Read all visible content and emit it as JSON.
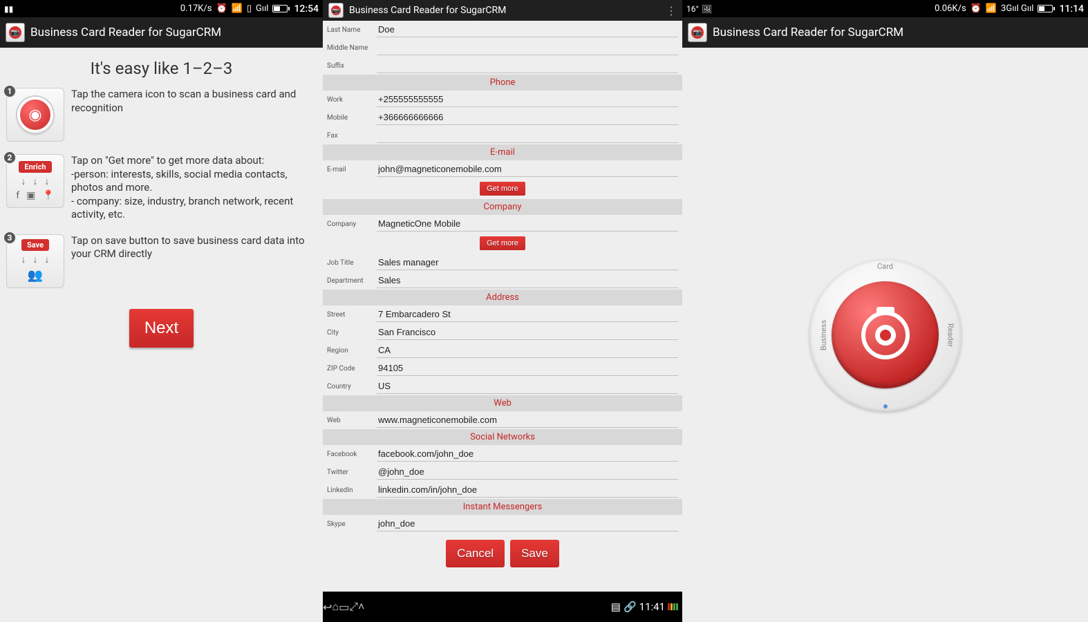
{
  "screen1": {
    "status": {
      "left_icon": "▮▮",
      "speed": "0.17K/s",
      "time": "12:54",
      "icons": [
        "⏰",
        "📶",
        "▯",
        "Gııl",
        "▭"
      ]
    },
    "appbar": {
      "title": "Business Card Reader for SugarCRM"
    },
    "heading": "It's easy like 1–2–3",
    "steps": [
      {
        "num": "1",
        "text": "Tap the camera icon to scan a business card and recognition"
      },
      {
        "num": "2",
        "text": "Tap on \"Get more\" to get more data about:\n-person: interests, skills, social media contacts, photos and more.\n- company: size, industry, branch network, recent activity, etc.",
        "tag": "Enrich",
        "sub_icons_top": [
          "↓",
          "↓",
          "↓"
        ],
        "sub_icons_bot": [
          "f",
          "▣",
          "📍"
        ]
      },
      {
        "num": "3",
        "text": "Tap on save button to save business card data into your CRM directly",
        "tag": "Save",
        "sub_icons_top": [
          "↓",
          "↓",
          "↓"
        ],
        "sub_icons_peeps": "👥"
      }
    ],
    "next": "Next"
  },
  "screen2": {
    "appbar": {
      "title": "Business Card Reader for SugarCRM"
    },
    "fields_top": [
      {
        "label": "Last Name",
        "value": "Doe"
      },
      {
        "label": "Middle Name",
        "value": ""
      },
      {
        "label": "Suffix",
        "value": ""
      }
    ],
    "sections": {
      "phone": {
        "head": "Phone",
        "rows": [
          {
            "label": "Work",
            "value": "+255555555555"
          },
          {
            "label": "Mobile",
            "value": "+366666666666"
          },
          {
            "label": "Fax",
            "value": ""
          }
        ]
      },
      "email": {
        "head": "E-mail",
        "rows": [
          {
            "label": "E-mail",
            "value": "john@magneticonemobile.com"
          }
        ],
        "getmore": "Get more"
      },
      "company": {
        "head": "Company",
        "rows": [
          {
            "label": "Company",
            "value": "MagneticOne Mobile"
          }
        ],
        "getmore": "Get more",
        "more_rows": [
          {
            "label": "Job Title",
            "value": "Sales manager"
          },
          {
            "label": "Department",
            "value": "Sales"
          }
        ]
      },
      "address": {
        "head": "Address",
        "rows": [
          {
            "label": "Street",
            "value": "7 Embarcadero St"
          },
          {
            "label": "City",
            "value": "San Francisco"
          },
          {
            "label": "Region",
            "value": "CA"
          },
          {
            "label": "ZIP Code",
            "value": "94105"
          },
          {
            "label": "Country",
            "value": "US"
          }
        ]
      },
      "web": {
        "head": "Web",
        "rows": [
          {
            "label": "Web",
            "value": "www.magneticonemobile.com"
          }
        ]
      },
      "social": {
        "head": "Social Networks",
        "rows": [
          {
            "label": "Facebook",
            "value": "facebook.com/john_doe"
          },
          {
            "label": "Twitter",
            "value": "@john_doe"
          },
          {
            "label": "LinkedIn",
            "value": "linkedin.com/in/john_doe"
          }
        ]
      },
      "im": {
        "head": "Instant Messengers",
        "rows": [
          {
            "label": "Skype",
            "value": "john_doe"
          }
        ]
      }
    },
    "buttons": {
      "cancel": "Cancel",
      "save": "Save"
    },
    "nav": {
      "time": "11:41"
    }
  },
  "screen3": {
    "status": {
      "temp": "16°",
      "speed": "0.06K/s",
      "time": "11:14",
      "net": "3Gııl Gııl",
      "batt": "40"
    },
    "appbar": {
      "title": "Business Card Reader for SugarCRM"
    },
    "dial": {
      "top": "Card",
      "left": "Business",
      "right": "Reader"
    }
  }
}
